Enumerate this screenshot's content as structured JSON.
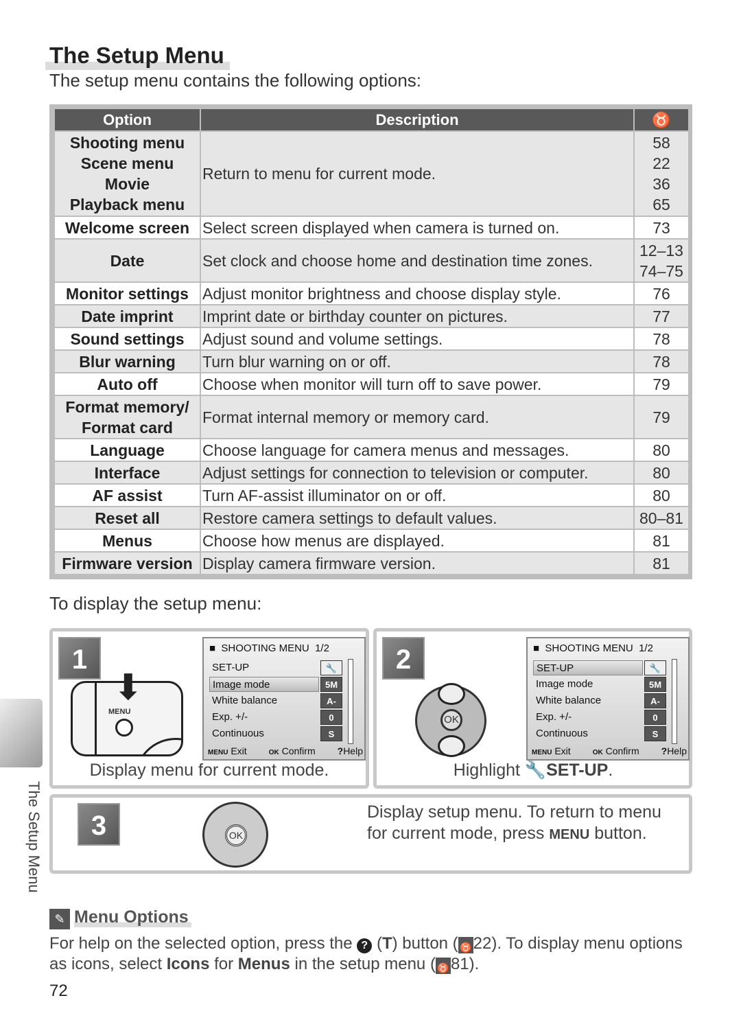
{
  "title": "The Setup Menu",
  "intro": "The setup menu contains the following options:",
  "table": {
    "headers": {
      "option": "Option",
      "description": "Description",
      "page_icon": "page-reference-icon"
    },
    "rows": [
      {
        "option": [
          "Shooting menu",
          "Scene menu",
          "Movie",
          "Playback menu"
        ],
        "description": "Return to menu for current mode.",
        "pages": [
          "58",
          "22",
          "36",
          "65"
        ]
      },
      {
        "option": [
          "Welcome screen"
        ],
        "description": "Select screen displayed when camera is turned on.",
        "pages": [
          "73"
        ]
      },
      {
        "option": [
          "Date"
        ],
        "description": "Set clock and choose home and destination time zones.",
        "pages": [
          "12–13",
          "74–75"
        ]
      },
      {
        "option": [
          "Monitor settings"
        ],
        "description": "Adjust monitor brightness and choose display style.",
        "pages": [
          "76"
        ]
      },
      {
        "option": [
          "Date imprint"
        ],
        "description": "Imprint date or birthday counter on pictures.",
        "pages": [
          "77"
        ]
      },
      {
        "option": [
          "Sound settings"
        ],
        "description": "Adjust sound and volume settings.",
        "pages": [
          "78"
        ]
      },
      {
        "option": [
          "Blur warning"
        ],
        "description": "Turn blur warning on or off.",
        "pages": [
          "78"
        ]
      },
      {
        "option": [
          "Auto off"
        ],
        "description": "Choose when monitor will turn off to save power.",
        "pages": [
          "79"
        ]
      },
      {
        "option": [
          "Format memory/",
          "Format card"
        ],
        "description": "Format internal memory or memory card.",
        "pages": [
          "79"
        ]
      },
      {
        "option": [
          "Language"
        ],
        "description": "Choose language for camera menus and messages.",
        "pages": [
          "80"
        ]
      },
      {
        "option": [
          "Interface"
        ],
        "description": "Adjust settings for connection to television or computer.",
        "pages": [
          "80"
        ]
      },
      {
        "option": [
          "AF assist"
        ],
        "description": "Turn AF-assist illuminator on or off.",
        "pages": [
          "80"
        ]
      },
      {
        "option": [
          "Reset all"
        ],
        "description": "Restore camera settings to default values.",
        "pages": [
          "80–81"
        ]
      },
      {
        "option": [
          "Menus"
        ],
        "description": "Choose how menus are displayed.",
        "pages": [
          "81"
        ]
      },
      {
        "option": [
          "Firmware version"
        ],
        "description": "Display camera firmware version.",
        "pages": [
          "81"
        ]
      }
    ]
  },
  "display_heading": "To display the setup menu:",
  "lcd": {
    "header": "SHOOTING MENU",
    "page": "1/2",
    "items": [
      "SET-UP",
      "Image mode",
      "White balance",
      "Exp. +/-",
      "Continuous"
    ],
    "values": [
      "5M",
      "A-WB",
      "0",
      "S"
    ],
    "footer": {
      "exit_key": "MENU",
      "exit": "Exit",
      "confirm_key": "OK",
      "confirm": "Confirm",
      "help_key": "?",
      "help": "Help"
    }
  },
  "steps": [
    {
      "number": "1",
      "caption": "Display menu for current mode.",
      "button_label": "MENU"
    },
    {
      "number": "2",
      "caption_pre": "Highlight",
      "caption_bold": "SET-UP",
      "caption_post": "."
    },
    {
      "number": "3",
      "caption_l1": "Display setup menu.  To return to menu",
      "caption_l2_pre": "for current mode, press",
      "caption_l2_key": "MENU",
      "caption_l2_post": "button."
    }
  ],
  "ok_label": "OK",
  "side_tab": "The Setup Menu",
  "tip": {
    "heading": "Menu Options",
    "t1": "For help on the selected option, press the",
    "t2": "(",
    "t3": "T",
    "t4": ") button (",
    "ref1": "22",
    "t5": ").  To display menu options as icons, select",
    "b1": "Icons",
    "t6": "for",
    "b2": "Menus",
    "t7": "in the setup menu (",
    "ref2": "81",
    "t8": ")."
  },
  "page_number": "72"
}
